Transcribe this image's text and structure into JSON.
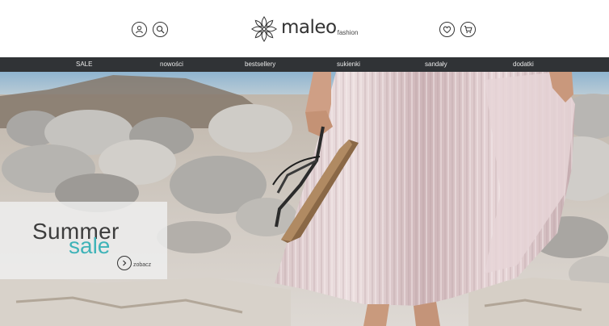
{
  "header": {
    "logo": {
      "name": "maleo",
      "suffix": "fashion"
    },
    "icons": {
      "account": "user-icon",
      "search": "search-icon",
      "wishlist": "heart-icon",
      "cart": "cart-icon"
    }
  },
  "nav": {
    "items": [
      {
        "label": "SALE"
      },
      {
        "label": "nowości"
      },
      {
        "label": "bestsellery"
      },
      {
        "label": "sukienki"
      },
      {
        "label": "sandały"
      },
      {
        "label": "dodatki"
      }
    ]
  },
  "hero": {
    "promo": {
      "title": "Summer",
      "subtitle": "sale",
      "cta_label": "zobacz"
    }
  },
  "colors": {
    "nav_background": "#303336",
    "accent": "#3fb3b8",
    "text": "#333333"
  }
}
